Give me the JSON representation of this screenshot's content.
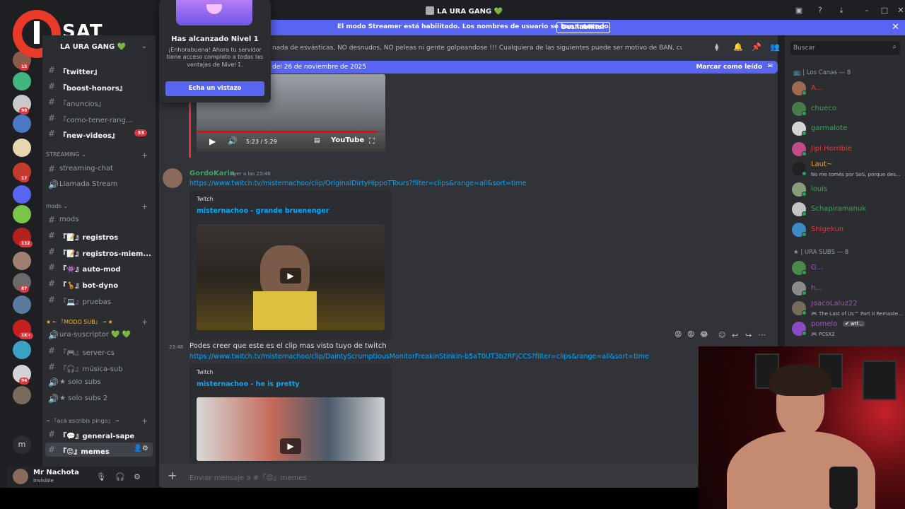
{
  "window": {
    "title": "LA URA GANG",
    "title_emoji": "💚"
  },
  "logo": {
    "text": "SAT",
    "letter": "I"
  },
  "streamer_banner": {
    "text": "El modo Streamer está habilitado. Los nombres de usuario se han truncado.",
    "button": "Deshabilitar",
    "close": "✕"
  },
  "server": {
    "name": "LA URA GANG",
    "name_emoji": "💚",
    "chevron": "⌄"
  },
  "servers": [
    {
      "badge": "15",
      "color": "#8a5a4a"
    },
    {
      "badge": "",
      "color": "#43b581"
    },
    {
      "badge": "98",
      "color": "#c9c9c9"
    },
    {
      "badge": "",
      "color": "#4a78c4"
    },
    {
      "badge": "",
      "color": "#e8d6b0"
    },
    {
      "badge": "17",
      "color": "#c43b2e"
    },
    {
      "badge": "",
      "color": "#5865f2"
    },
    {
      "badge": "",
      "color": "#7ac44a"
    },
    {
      "badge": "132",
      "color": "#b32020"
    },
    {
      "badge": "",
      "color": "#a08070"
    },
    {
      "badge": "87",
      "color": "#6a6a6a"
    },
    {
      "badge": "",
      "color": "#5a7aa0"
    },
    {
      "badge": "1K+",
      "color": "#c42020"
    },
    {
      "badge": "",
      "color": "#3aa0c4"
    },
    {
      "badge": "94",
      "color": "#d4d4d4"
    },
    {
      "badge": "",
      "color": "#7a6a5a"
    }
  ],
  "rail_dm_letter": "m",
  "channels": [
    {
      "label": "『twitter』",
      "type": "text",
      "bold": true,
      "badge": ""
    },
    {
      "label": "『boost-honors』",
      "type": "text",
      "bold": true,
      "badge": ""
    },
    {
      "label": "『anuncios』",
      "type": "text",
      "bold": false,
      "badge": ""
    },
    {
      "label": "『como-tener-rang...",
      "type": "text",
      "bold": false,
      "badge": ""
    },
    {
      "label": "『new-videos』",
      "type": "text",
      "bold": true,
      "badge": "33"
    }
  ],
  "categories": {
    "streaming": "STREAMING ⌄",
    "mods": "mods ⌄",
    "modo_sub": "★ ╾ 『MODO SUB』 ╼ ★",
    "aca": "╼ 『acá escribís pingo』 ╼"
  },
  "streaming_channels": [
    {
      "label": "streaming-chat",
      "icon": "#"
    },
    {
      "label": "Llamada Stream",
      "icon": "🔊"
    }
  ],
  "mods_channels": [
    {
      "label": "mods",
      "bold": false
    },
    {
      "label": "『📝』registros",
      "bold": true
    },
    {
      "label": "『📝』registros-miem...",
      "bold": true
    },
    {
      "label": "『👾』auto-mod",
      "bold": true
    },
    {
      "label": "『🦒』bot-dyno",
      "bold": true
    },
    {
      "label": "『💻』pruebas",
      "bold": false
    }
  ],
  "sub_channels": [
    {
      "label": "ura-suscriptor 💚 💚",
      "icon": "🔊"
    },
    {
      "label": "『🎮』server-cs",
      "icon": "#"
    },
    {
      "label": "『🎧』música-sub",
      "icon": "#"
    },
    {
      "label": "★ solo subs",
      "icon": "🔊"
    },
    {
      "label": "★ solo subs 2",
      "icon": "🔊"
    }
  ],
  "last_channels": [
    {
      "label": "『💬』general-sape",
      "bold": true
    },
    {
      "label": "『😡』memes",
      "bold": true
    }
  ],
  "user": {
    "name": "Mr Nachota",
    "status": "Invisible",
    "mic": "🎙",
    "headphones": "🎧",
    "settings": "⚙"
  },
  "topic": "nada de esvásticas, NO desnudos, NO peleas ni gente golpeandose !!! Cualquiera de las siguientes puede ser motivo de BAN, cuiden el stream!",
  "new_messages": {
    "text": "del 26 de noviembre de 2025",
    "action": "Marcar como leído"
  },
  "video1": {
    "time": "5:23 / 5:29",
    "brand": "YouTube"
  },
  "message1": {
    "author": "GordoKarin",
    "timestamp": "ayer a las 23:46",
    "link": "https://www.twitch.tv/misternachoo/clip/OriginalDirtyHippoTTours?filter=clips&range=all&sort=time",
    "provider": "Twitch",
    "embed_title": "misternachoo - grande bruenenger"
  },
  "message2": {
    "timestamp": "23:48",
    "text": "Podes creer que este es el clip mas visto tuyo de twitch",
    "link": "https://www.twitch.tv/misternachoo/clip/DaintyScrumptiousMonitorFreakinStinkin-b5aT0UT3b2RFjCCS?filter=clips&range=all&sort=time",
    "provider": "Twitch",
    "embed_title": "misternachoo - he is pretty"
  },
  "composer": {
    "placeholder": "Enviar mensaje a #『😡』memes"
  },
  "member_search": {
    "placeholder": "Buscar"
  },
  "member_groups": [
    {
      "header": "📺 | Los Canas — 8",
      "members": [
        {
          "name": "A...",
          "color": "#e03c3c",
          "sub": "",
          "av": "#a06a50"
        },
        {
          "name": "chueco",
          "color": "#3ba55c",
          "sub": "",
          "av": "#4a7a4a"
        },
        {
          "name": "garmalote",
          "color": "#3ba55c",
          "sub": "",
          "av": "#d4d4d4"
        },
        {
          "name": "Jipi Horrible",
          "color": "#e03c3c",
          "sub": "",
          "av": "#c44a8a"
        },
        {
          "name": "Laut~",
          "color": "#e0a030",
          "sub": "No me tomés por SoS, porque des...",
          "av": "#222"
        },
        {
          "name": "louis",
          "color": "#3ba55c",
          "sub": "",
          "av": "#8a9a7a"
        },
        {
          "name": "Schapiramanuk",
          "color": "#3ba55c",
          "sub": "",
          "av": "#c4c4c4"
        },
        {
          "name": "Shigekun",
          "color": "#e03c3c",
          "sub": "",
          "av": "#3a8ac4"
        }
      ]
    },
    {
      "header": "★ | URA SUBS — 8",
      "members": [
        {
          "name": "G...",
          "color": "#9b59b6",
          "sub": "",
          "av": "#4a8a4a"
        },
        {
          "name": "h...",
          "color": "#9b59b6",
          "sub": "",
          "av": "#8a8a8a"
        },
        {
          "name": "JoacoLaluz22",
          "color": "#9b59b6",
          "sub": "🎮 The Last of Us™ Part II Remaste...",
          "av": "#7a6a5a"
        },
        {
          "name": "pomelo",
          "color": "#9b59b6",
          "sub": "🎮 PCSX2",
          "av": "#8a4ac4",
          "tag": "✔ wtf..."
        }
      ]
    }
  ],
  "popup": {
    "title": "Has alcanzado Nivel 1",
    "body": "¡Enhorabuena! Ahora tu servidor tiene acceso completo a todas las ventajas de Nivel 1.",
    "button": "Echa un vistazo"
  },
  "colors": {
    "blurple": "#5865f2",
    "link": "#00a8fc",
    "danger": "#da373c"
  }
}
